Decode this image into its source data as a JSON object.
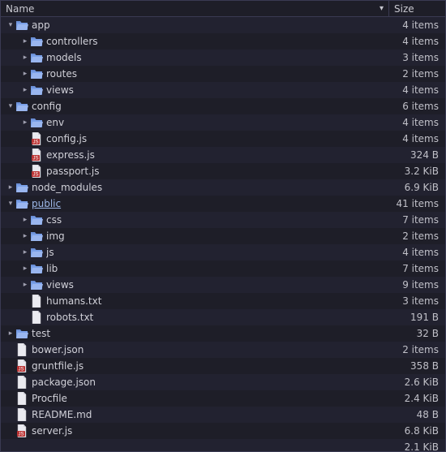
{
  "header": {
    "name": "Name",
    "size": "Size"
  },
  "rows": [
    {
      "depth": 0,
      "exp": "down",
      "kind": "folder",
      "name": "app",
      "size": "4 items"
    },
    {
      "depth": 1,
      "exp": "right",
      "kind": "folder",
      "name": "controllers",
      "size": "4 items"
    },
    {
      "depth": 1,
      "exp": "right",
      "kind": "folder",
      "name": "models",
      "size": "3 items"
    },
    {
      "depth": 1,
      "exp": "right",
      "kind": "folder",
      "name": "routes",
      "size": "2 items"
    },
    {
      "depth": 1,
      "exp": "right",
      "kind": "folder",
      "name": "views",
      "size": "4 items"
    },
    {
      "depth": 0,
      "exp": "down",
      "kind": "folder",
      "name": "config",
      "size": "6 items"
    },
    {
      "depth": 1,
      "exp": "right",
      "kind": "folder",
      "name": "env",
      "size": "4 items"
    },
    {
      "depth": 1,
      "exp": "none",
      "kind": "js",
      "name": "config.js",
      "size": "4 items"
    },
    {
      "depth": 1,
      "exp": "none",
      "kind": "js",
      "name": "express.js",
      "size": "324 B"
    },
    {
      "depth": 1,
      "exp": "none",
      "kind": "js",
      "name": "passport.js",
      "size": "3.2 KiB"
    },
    {
      "depth": 0,
      "exp": "right",
      "kind": "folder",
      "name": "node_modules",
      "size": "6.9 KiB"
    },
    {
      "depth": 0,
      "exp": "down",
      "kind": "folder",
      "name": "public",
      "size": "41 items",
      "selected": true
    },
    {
      "depth": 1,
      "exp": "right",
      "kind": "folder",
      "name": "css",
      "size": "7 items"
    },
    {
      "depth": 1,
      "exp": "right",
      "kind": "folder",
      "name": "img",
      "size": "2 items"
    },
    {
      "depth": 1,
      "exp": "right",
      "kind": "folder",
      "name": "js",
      "size": "4 items"
    },
    {
      "depth": 1,
      "exp": "right",
      "kind": "folder",
      "name": "lib",
      "size": "7 items"
    },
    {
      "depth": 1,
      "exp": "right",
      "kind": "folder",
      "name": "views",
      "size": "9 items"
    },
    {
      "depth": 1,
      "exp": "none",
      "kind": "file",
      "name": "humans.txt",
      "size": "3 items"
    },
    {
      "depth": 1,
      "exp": "none",
      "kind": "file",
      "name": "robots.txt",
      "size": "191 B"
    },
    {
      "depth": 0,
      "exp": "right",
      "kind": "folder",
      "name": "test",
      "size": "32 B"
    },
    {
      "depth": 0,
      "exp": "none",
      "kind": "file",
      "name": "bower.json",
      "size": "2 items"
    },
    {
      "depth": 0,
      "exp": "none",
      "kind": "js",
      "name": "gruntfile.js",
      "size": "358 B"
    },
    {
      "depth": 0,
      "exp": "none",
      "kind": "file",
      "name": "package.json",
      "size": "2.6 KiB"
    },
    {
      "depth": 0,
      "exp": "none",
      "kind": "file",
      "name": "Procfile",
      "size": "2.4 KiB"
    },
    {
      "depth": 0,
      "exp": "none",
      "kind": "file",
      "name": "README.md",
      "size": "48 B"
    },
    {
      "depth": 0,
      "exp": "none",
      "kind": "js",
      "name": "server.js",
      "size": "6.8 KiB"
    },
    {
      "depth": 0,
      "exp": "blank",
      "kind": "blank",
      "name": "",
      "size": "2.1 KiB"
    }
  ]
}
